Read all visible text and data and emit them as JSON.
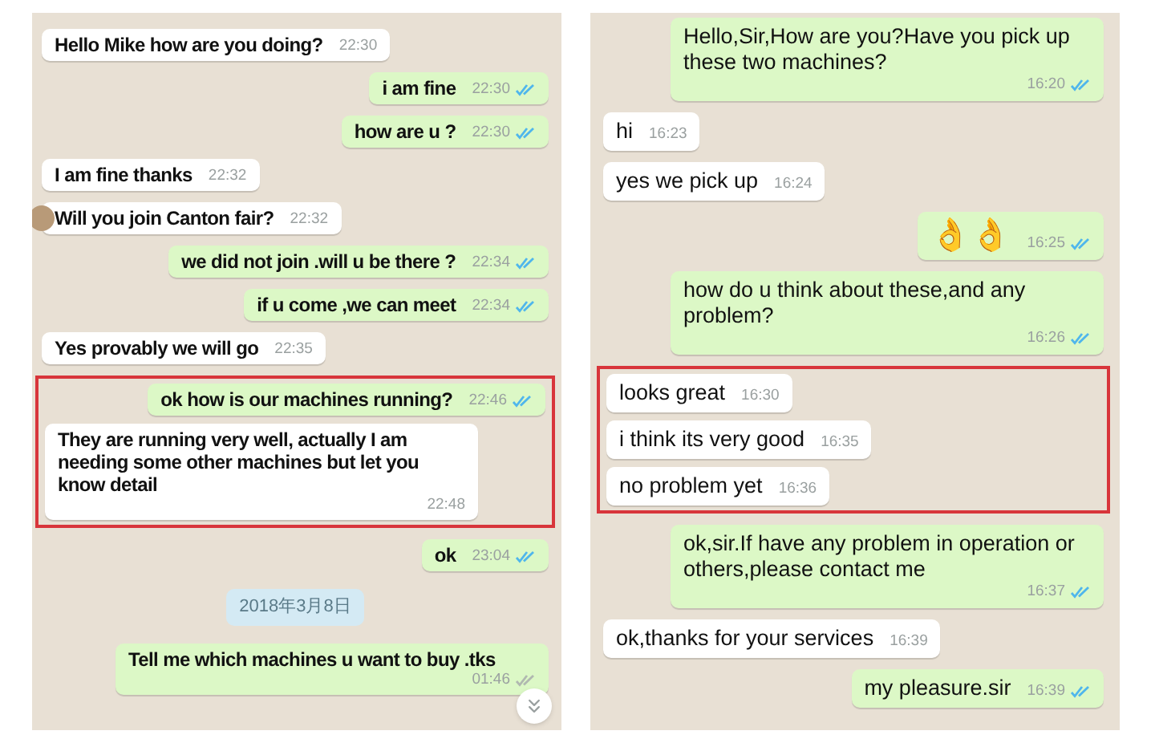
{
  "chats": [
    {
      "items": [
        {
          "kind": "message",
          "outgoing": false,
          "text": "Hello Mike how are you doing?",
          "time": "22:30"
        },
        {
          "kind": "message",
          "outgoing": true,
          "text": "i am fine",
          "time": "22:30",
          "read": true
        },
        {
          "kind": "message",
          "outgoing": true,
          "text": "how are u ?",
          "time": "22:30",
          "read": true
        },
        {
          "kind": "message",
          "outgoing": false,
          "text": "I am fine thanks",
          "time": "22:32"
        },
        {
          "kind": "message",
          "outgoing": false,
          "text": "Will you join Canton fair?",
          "time": "22:32",
          "avatar": true
        },
        {
          "kind": "message",
          "outgoing": true,
          "text": "we did not join .will u be there ?",
          "time": "22:34",
          "read": true
        },
        {
          "kind": "message",
          "outgoing": true,
          "text": "if u come ,we can meet",
          "time": "22:34",
          "read": true
        },
        {
          "kind": "message",
          "outgoing": false,
          "text": "Yes provably we will go",
          "time": "22:35"
        },
        {
          "kind": "group",
          "messages": [
            {
              "outgoing": true,
              "text": "ok how is our machines running?",
              "time": "22:46",
              "read": true
            },
            {
              "outgoing": false,
              "text": "They are running very well, actually I am needing some other machines but let you know detail",
              "time": "22:48"
            }
          ]
        },
        {
          "kind": "message",
          "outgoing": true,
          "text": "ok",
          "time": "23:04",
          "read": true
        },
        {
          "kind": "date",
          "text": "2018年3月8日"
        },
        {
          "kind": "message",
          "outgoing": true,
          "text": "Tell me which machines u want to buy .tks",
          "time": "01:46",
          "read": false
        }
      ],
      "scroll_button": true
    },
    {
      "items": [
        {
          "kind": "message",
          "outgoing": true,
          "text": "Hello,Sir,How are you?Have you pick up these two machines?",
          "time": "16:20",
          "read": true
        },
        {
          "kind": "message",
          "outgoing": false,
          "text": "hi",
          "time": "16:23"
        },
        {
          "kind": "message",
          "outgoing": false,
          "text": "yes  we pick up",
          "time": "16:24"
        },
        {
          "kind": "emoji",
          "outgoing": true,
          "text": "👌👌",
          "time": "16:25",
          "read": true
        },
        {
          "kind": "message",
          "outgoing": true,
          "text": "how do u think about these,and any problem?",
          "time": "16:26",
          "read": true
        },
        {
          "kind": "group",
          "messages": [
            {
              "outgoing": false,
              "text": "looks great",
              "time": "16:30"
            },
            {
              "outgoing": false,
              "text": "i think its very good",
              "time": "16:35"
            },
            {
              "outgoing": false,
              "text": "no problem yet",
              "time": "16:36"
            }
          ]
        },
        {
          "kind": "message",
          "outgoing": true,
          "text": "ok,sir.If have any problem in operation or others,please contact me",
          "time": "16:37",
          "read": true
        },
        {
          "kind": "message",
          "outgoing": false,
          "text": "ok,thanks for your services",
          "time": "16:39"
        },
        {
          "kind": "message",
          "outgoing": true,
          "text": "my pleasure.sir",
          "time": "16:39",
          "read": true
        }
      ],
      "scroll_button": false
    }
  ]
}
